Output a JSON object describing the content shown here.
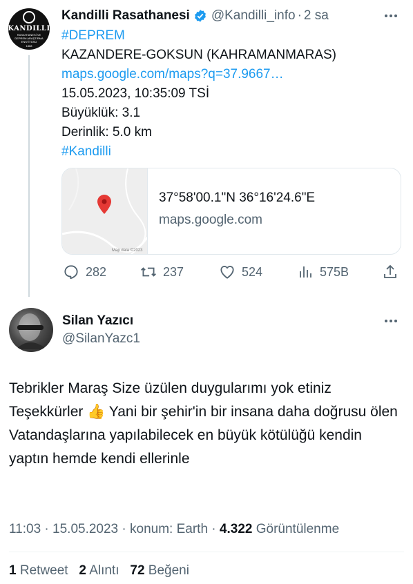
{
  "tweet1": {
    "author_name": "Kandilli Rasathanesi",
    "handle": "@Kandilli_info",
    "separator": "·",
    "time": "2 sa",
    "avatar": {
      "title": "KANDILLI",
      "subtitle": "RASATHANESİ VE DEPREM ARAŞTIRMA ENSTİTÜSÜ",
      "year": "1868"
    },
    "lines": [
      "#DEPREM",
      "KAZANDERE-GOKSUN (KAHRAMANMARAS)",
      "maps.google.com/maps?q=37.9667…",
      "15.05.2023, 10:35:09 TSİ",
      "Büyüklük: 3.1",
      "Derinlik: 5.0 km",
      "#Kandilli"
    ],
    "card": {
      "title": "37°58'00.1\"N 36°16'24.6\"E",
      "domain": "maps.google.com",
      "map_caption": "Map data ©2023"
    },
    "actions": {
      "reply_count": "282",
      "retweet_count": "237",
      "like_count": "524",
      "views_count": "575B"
    }
  },
  "tweet2": {
    "author_name": "Silan Yazıcı",
    "handle": "@SilanYazc1",
    "body": "Tebrikler Maraş Size üzülen duygularımı yok etiniz Teşekkürler 👍 Yani bir şehir'in bir insana daha doğrusu ölen Vatandaşlarına yapılabilecek en büyük kötülüğü kendin yaptın hemde kendi ellerinle",
    "meta": {
      "time": "11:03",
      "dot": "·",
      "date": "15.05.2023",
      "location": "konum: Earth",
      "views": "4.322",
      "views_label": "Görüntülenme"
    },
    "stats": {
      "retweets": "1",
      "retweets_label": "Retweet",
      "quotes": "2",
      "quotes_label": "Alıntı",
      "likes": "72",
      "likes_label": "Beğeni"
    }
  },
  "colors": {
    "link": "#1d9bf0",
    "muted": "#536471",
    "text": "#0f1419",
    "pin": "#e53935"
  },
  "icons": [
    "verified-badge-icon",
    "more-icon",
    "map-pin-icon",
    "reply-icon",
    "retweet-icon",
    "like-icon",
    "views-icon",
    "share-icon"
  ]
}
